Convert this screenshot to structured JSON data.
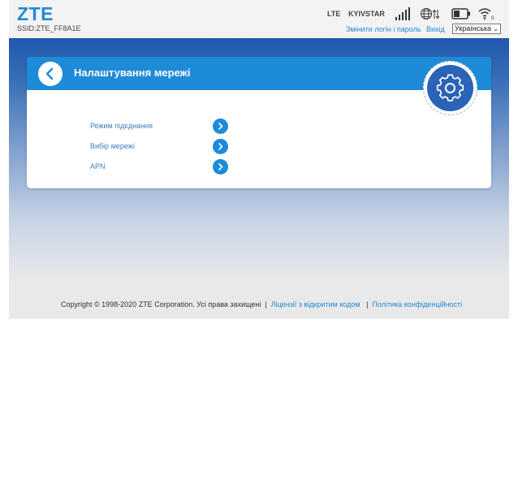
{
  "header": {
    "logo": "ZTE",
    "ssid": "SSID:ZTE_FF8A1E",
    "network_type": "LTE",
    "carrier": "KYIVSTAR",
    "links": {
      "change_login": "Змінити логін і пароль",
      "logout": "Вихід"
    },
    "language": {
      "selected": "Українська"
    },
    "icons": [
      "signal-bars-icon",
      "globe-data-icon",
      "battery-icon",
      "wifi-icon"
    ],
    "wifi_clients": "0"
  },
  "card": {
    "title": "Налаштування мережі",
    "items": [
      {
        "label": "Режим підєднання"
      },
      {
        "label": "Вибір мережі"
      },
      {
        "label": "APN"
      }
    ]
  },
  "footer": {
    "copyright": "Copyright © 1998-2020 ZTE Corporation. Усі права захищені",
    "sep": "|",
    "open_source": "Ліцензії з відкритим кодом",
    "privacy": "Політика конфіденційності"
  },
  "colors": {
    "accent": "#1d8bd8",
    "band": "#1f58ad",
    "gear": "#2a63b7"
  }
}
